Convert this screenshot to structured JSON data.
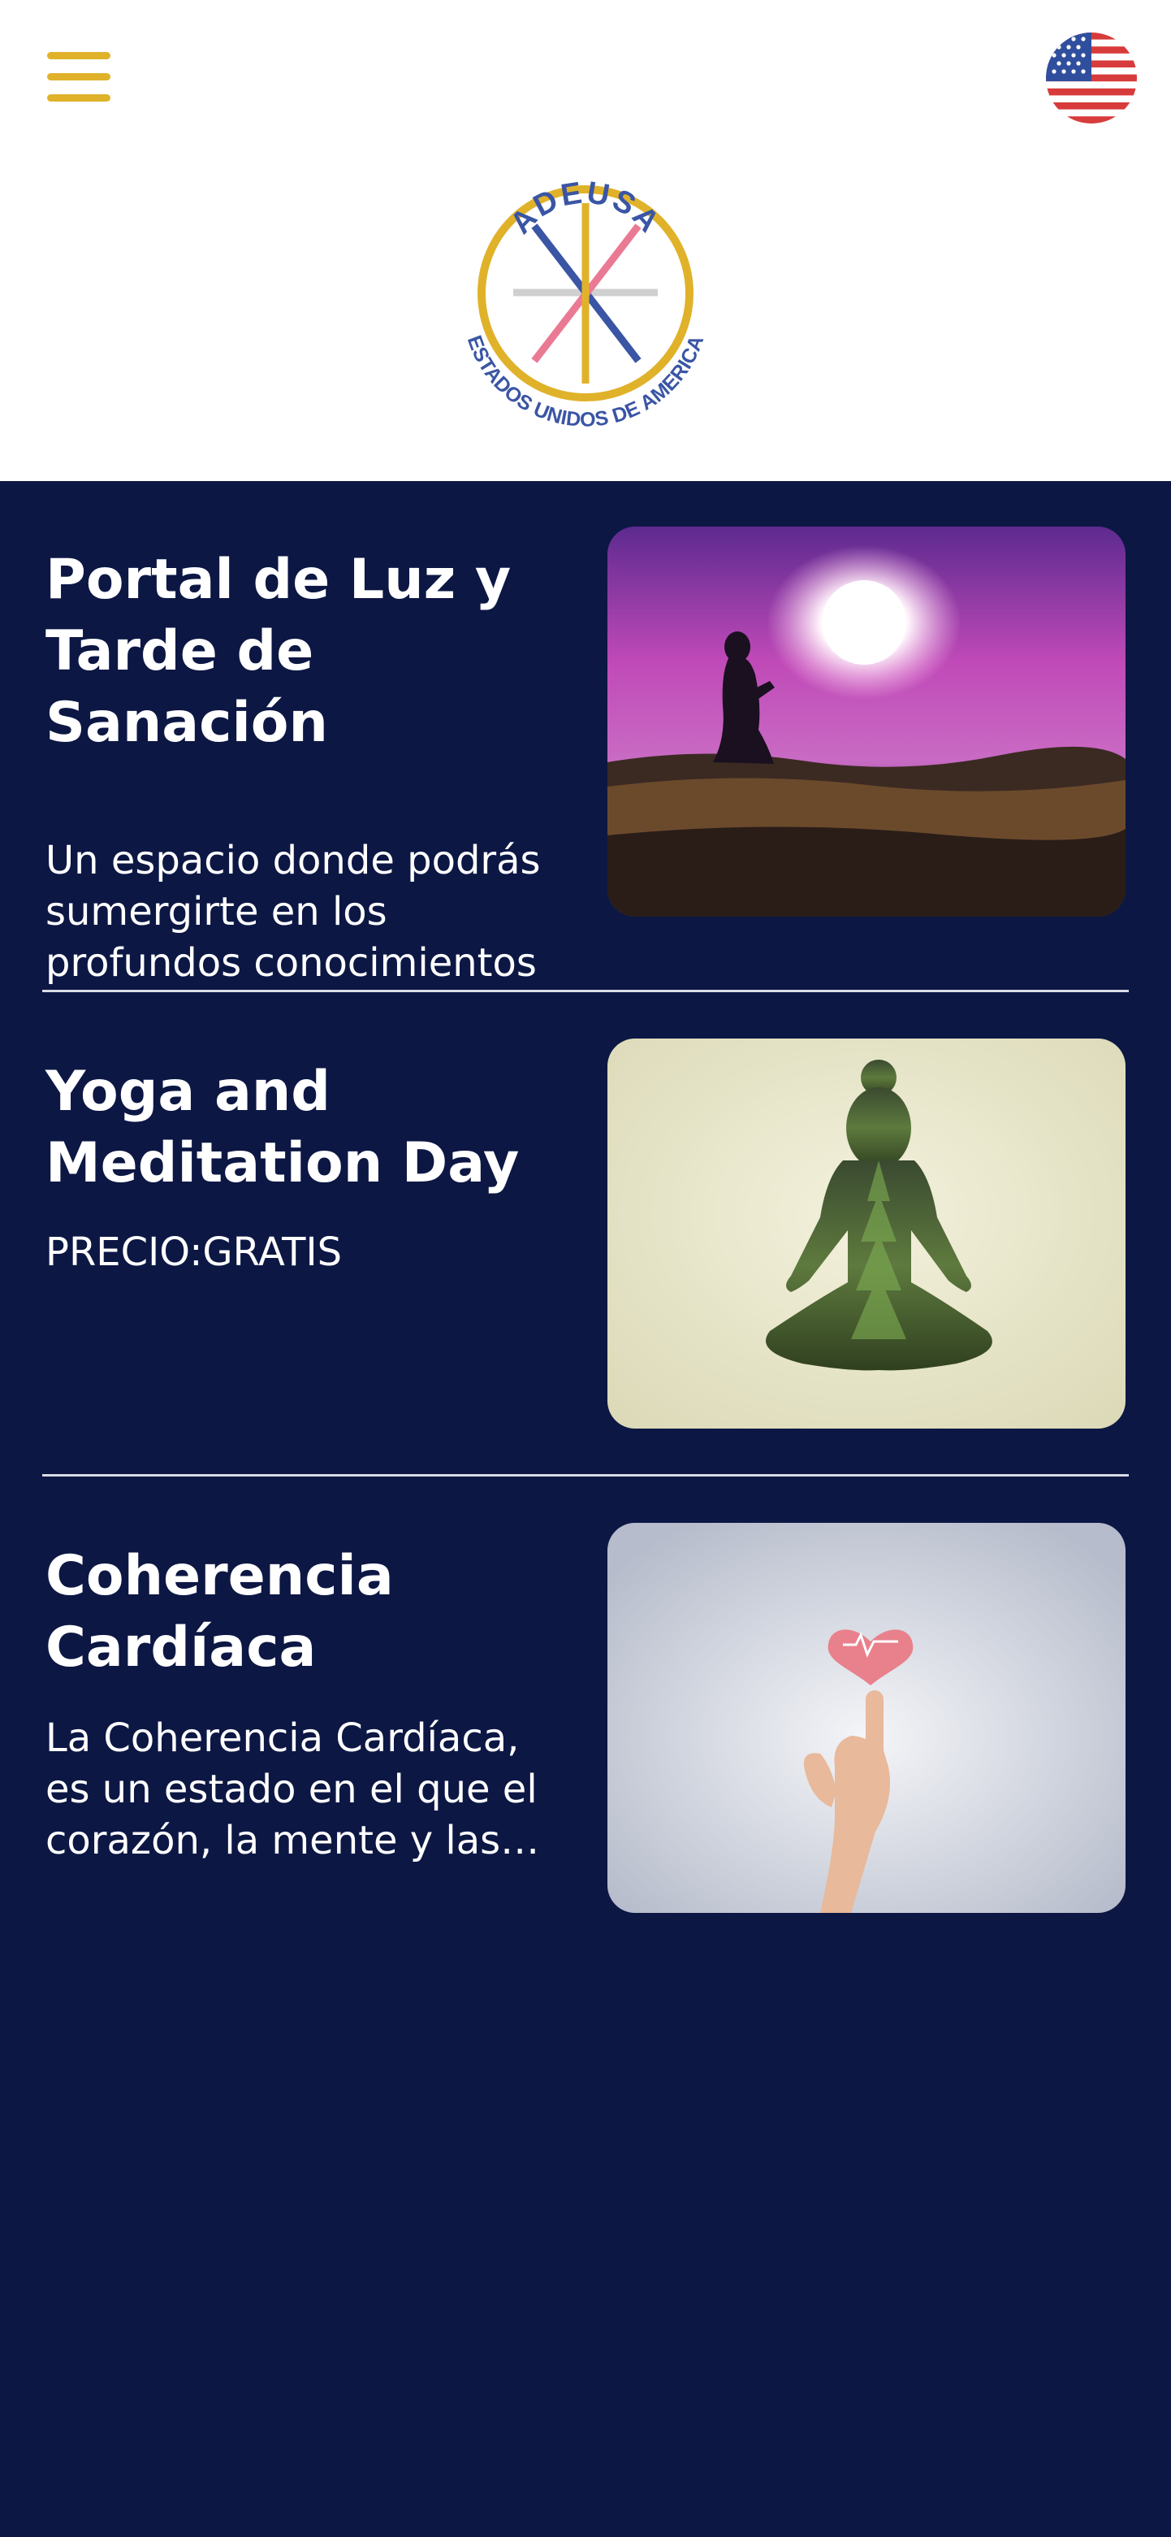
{
  "header": {
    "menu_icon": "hamburger-menu-icon",
    "language_icon": "us-flag-icon",
    "logo": {
      "top_text": "ADEUSA",
      "bottom_text": "ESTADOS UNIDOS DE AMERICA",
      "colors": {
        "ring": "#e0b22a",
        "blue": "#3a55a4",
        "pink": "#ea7a94",
        "gray": "#d0d0d0"
      }
    }
  },
  "events": [
    {
      "title": "Portal de Luz y Tarde de Sanación",
      "description": "Un espacio donde podrás sumergirte en los profundos conocimientos",
      "image": "purple-sunset-meditation-image"
    },
    {
      "title": "Yoga and Meditation Day",
      "description": "PRECIO:GRATIS",
      "image": "yoga-forest-silhouette-image"
    },
    {
      "title": "Coherencia Cardíaca",
      "description": "La Coherencia Cardíaca, es un estado en el que el corazón, la mente y las emociones",
      "image": "heart-on-finger-image"
    }
  ],
  "colors": {
    "background": "#0c1744",
    "header_bg": "#ffffff",
    "accent_yellow": "#e0b22a",
    "text": "#ffffff",
    "divider": "#d9dce6"
  }
}
